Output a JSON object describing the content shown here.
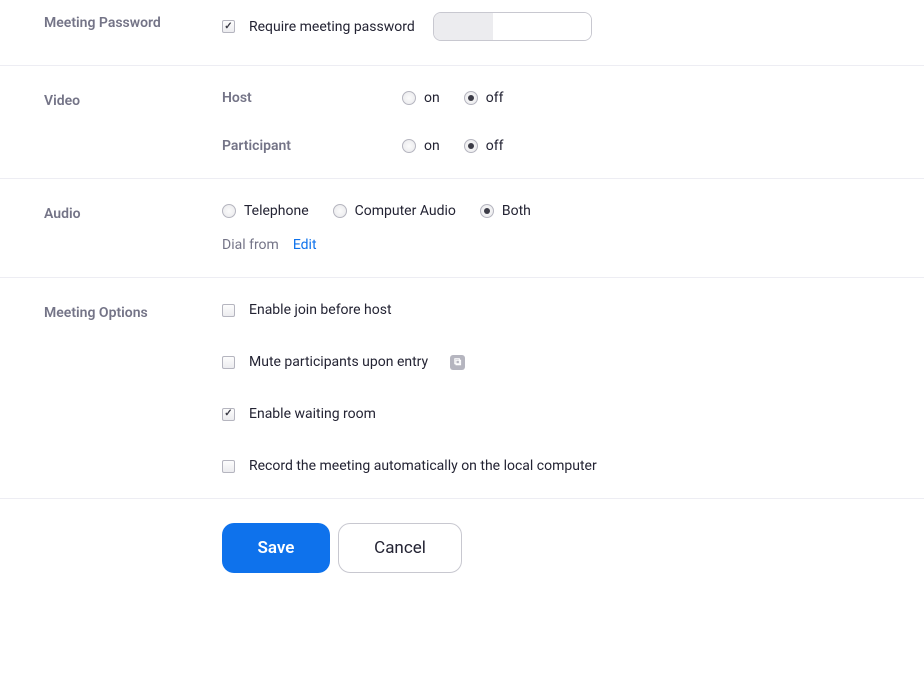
{
  "sections": {
    "password": {
      "title": "Meeting Password",
      "require_label": "Require meeting password",
      "require_checked": true
    },
    "video": {
      "title": "Video",
      "host_label": "Host",
      "participant_label": "Participant",
      "on": "on",
      "off": "off",
      "host_value": "off",
      "participant_value": "off"
    },
    "audio": {
      "title": "Audio",
      "telephone": "Telephone",
      "computer": "Computer Audio",
      "both": "Both",
      "value": "both",
      "dial_from": "Dial from",
      "edit": "Edit"
    },
    "options": {
      "title": "Meeting Options",
      "join_before": {
        "label": "Enable join before host",
        "checked": false
      },
      "mute_entry": {
        "label": "Mute participants upon entry",
        "checked": false
      },
      "waiting_room": {
        "label": "Enable waiting room",
        "checked": true
      },
      "record_local": {
        "label": "Record the meeting automatically on the local computer",
        "checked": false
      }
    }
  },
  "buttons": {
    "save": "Save",
    "cancel": "Cancel"
  }
}
